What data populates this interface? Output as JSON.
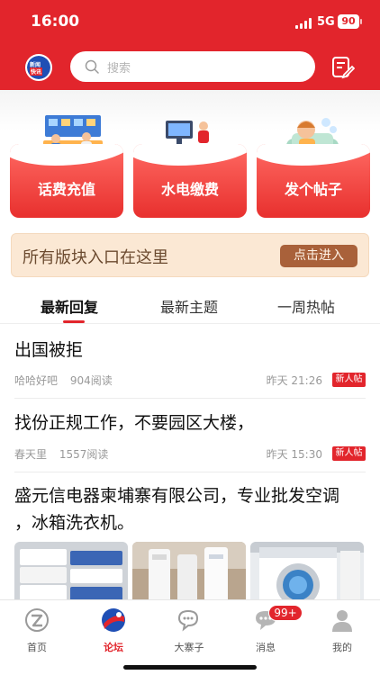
{
  "status": {
    "time": "16:00",
    "network": "5G",
    "battery": "90"
  },
  "header": {
    "logo_top": "新闻",
    "logo_bottom": "快讯",
    "search_placeholder": "搜索"
  },
  "quick_actions": [
    {
      "label": "话费充值",
      "icon": "shop-counter-illustration"
    },
    {
      "label": "水电缴费",
      "icon": "desk-computer-illustration"
    },
    {
      "label": "发个帖子",
      "icon": "sofa-person-illustration"
    }
  ],
  "banner": {
    "text": "所有版块入口在这里",
    "button": "点击进入"
  },
  "tabs": [
    {
      "label": "最新回复",
      "active": true
    },
    {
      "label": "最新主题",
      "active": false
    },
    {
      "label": "一周热帖",
      "active": false
    }
  ],
  "posts": [
    {
      "title": "出国被拒",
      "author": "哈哈好吧",
      "reads": "904阅读",
      "time": "昨天 21:26",
      "badge": "新人帖"
    },
    {
      "title": "找份正规工作，不要园区大楼，",
      "author": "春天里",
      "reads": "1557阅读",
      "time": "昨天 15:30",
      "badge": "新人帖"
    },
    {
      "title_line1": "盛元信电器柬埔寨有限公司，专业批发空调",
      "title_line2": "，冰箱洗衣机。"
    }
  ],
  "bottom_nav": [
    {
      "label": "首页",
      "icon": "home-logo-icon",
      "active": false
    },
    {
      "label": "论坛",
      "icon": "forum-icon",
      "active": true
    },
    {
      "label": "大寨子",
      "icon": "chat-bubbles-icon",
      "active": false
    },
    {
      "label": "消息",
      "icon": "message-icon",
      "active": false
    },
    {
      "label": "我的",
      "icon": "profile-icon",
      "active": false
    }
  ],
  "message_badge": "99+",
  "colors": {
    "brand_red": "#e2252c",
    "banner_bg": "#fbe8d4",
    "banner_button": "#a9613a"
  }
}
